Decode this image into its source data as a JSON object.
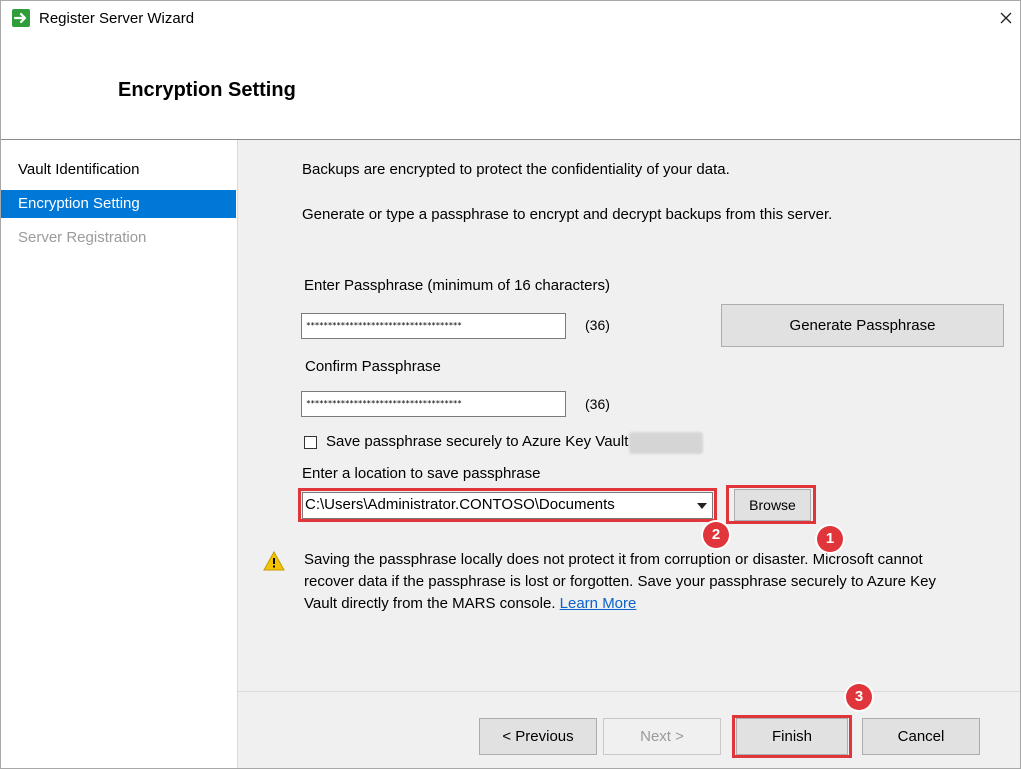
{
  "window": {
    "title": "Register Server Wizard",
    "page_title": "Encryption Setting"
  },
  "sidebar": {
    "items": [
      {
        "label": "Vault Identification",
        "state": "normal"
      },
      {
        "label": "Encryption Setting",
        "state": "active"
      },
      {
        "label": "Server Registration",
        "state": "disabled"
      }
    ]
  },
  "content": {
    "intro_line1": "Backups are encrypted to protect the confidentiality of your data.",
    "intro_line2": "Generate or type a passphrase to encrypt and decrypt backups from this server.",
    "passphrase_label": "Enter Passphrase (minimum of 16 characters)",
    "passphrase_value": "************************************",
    "passphrase_count": "(36)",
    "generate_button": "Generate Passphrase",
    "confirm_label": "Confirm Passphrase",
    "confirm_value": "************************************",
    "confirm_count": "(36)",
    "keyvault_checkbox_label": "Save passphrase securely to Azure Key Vault",
    "keyvault_checked": false,
    "location_label": "Enter a location to save passphrase",
    "location_value": "C:\\Users\\Administrator.CONTOSO\\Documents",
    "browse_button": "Browse",
    "warning_line1": "Saving the passphrase locally does not protect it from corruption or disaster. Microsoft cannot",
    "warning_line2": "recover data if the passphrase is lost or forgotten. Save your passphrase securely to Azure Key",
    "warning_line3_prefix": "Vault directly from the MARS console. ",
    "learn_more": "Learn More"
  },
  "footer": {
    "previous": "< Previous",
    "next": "Next >",
    "finish": "Finish",
    "cancel": "Cancel"
  },
  "annotations": {
    "marker_1": "1",
    "marker_2": "2",
    "marker_3": "3"
  },
  "colors": {
    "accent": "#0078d7",
    "highlight_red": "#e0353a",
    "link": "#0b62c9",
    "warning_yellow": "#f5c400"
  },
  "icons": {
    "app": "wizard-arrow-icon",
    "close": "close-icon",
    "warning": "warning-icon",
    "dropdown": "chevron-down-icon"
  }
}
